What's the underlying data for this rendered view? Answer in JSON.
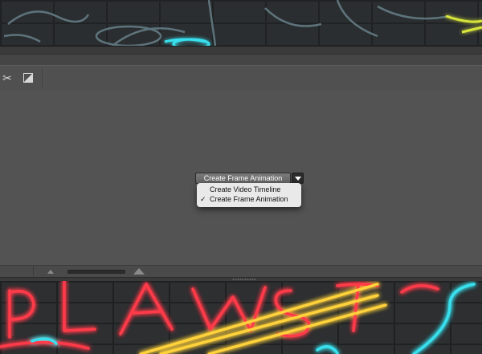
{
  "timeline_panel": {
    "create_button_label": "Create Frame Animation",
    "dropdown_menu": {
      "items": [
        {
          "label": "Create Video Timeline",
          "checked": false
        },
        {
          "label": "Create Frame Animation",
          "checked": true
        }
      ],
      "check_mark": "✓"
    },
    "toolbar_icons": [
      "scissors-icon",
      "transition-icon"
    ],
    "toolbar_glyphs": {
      "scissors": "✂"
    }
  },
  "canvas_artwork": {
    "description_colors": {
      "neon_red": "#ff3b4a",
      "neon_yellow": "#ffd23a",
      "neon_cyan": "#38e0ee",
      "neon_blue_dim": "#4a8fa0"
    }
  }
}
